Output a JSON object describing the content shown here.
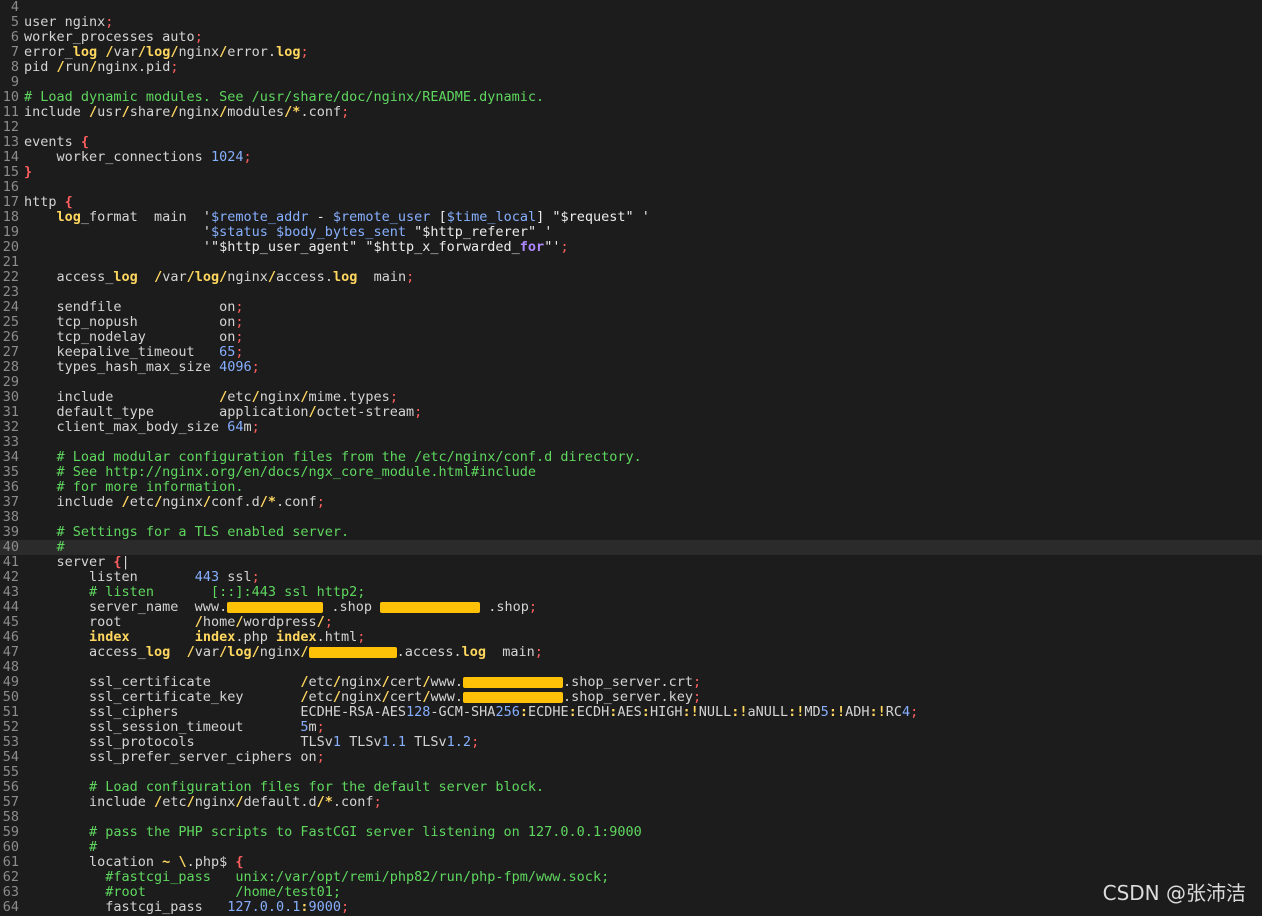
{
  "watermark": "CSDN @张沛洁",
  "colors": {
    "background": "#1c1c1c",
    "comment": "#5fd75f",
    "keyword": "#ffd75f",
    "number": "#87afff",
    "brace": "#ff5f5f",
    "redaction": "#ffc107"
  },
  "lines": [
    {
      "n": "4",
      "tokens": []
    },
    {
      "n": "5",
      "tokens": [
        [
          "",
          "user nginx"
        ],
        [
          "sp",
          ";"
        ]
      ]
    },
    {
      "n": "6",
      "tokens": [
        [
          "",
          "worker_processes auto"
        ],
        [
          "sp",
          ";"
        ]
      ]
    },
    {
      "n": "7",
      "tokens": [
        [
          "",
          "error_"
        ],
        [
          "kw",
          "log"
        ],
        [
          "",
          " "
        ],
        [
          "op",
          "/"
        ],
        [
          "",
          "var"
        ],
        [
          "op",
          "/"
        ],
        [
          "kw",
          "log"
        ],
        [
          "op",
          "/"
        ],
        [
          "",
          "nginx"
        ],
        [
          "op",
          "/"
        ],
        [
          "",
          "error."
        ],
        [
          "kw",
          "log"
        ],
        [
          "sp",
          ";"
        ]
      ]
    },
    {
      "n": "8",
      "tokens": [
        [
          "",
          "pid "
        ],
        [
          "op",
          "/"
        ],
        [
          "",
          "run"
        ],
        [
          "op",
          "/"
        ],
        [
          "",
          "nginx.pid"
        ],
        [
          "sp",
          ";"
        ]
      ]
    },
    {
      "n": "9",
      "tokens": []
    },
    {
      "n": "10",
      "tokens": [
        [
          "cm",
          "# Load dynamic modules. See /usr/share/doc/nginx/README.dynamic."
        ]
      ]
    },
    {
      "n": "11",
      "tokens": [
        [
          "",
          "include "
        ],
        [
          "op",
          "/"
        ],
        [
          "",
          "usr"
        ],
        [
          "op",
          "/"
        ],
        [
          "",
          "share"
        ],
        [
          "op",
          "/"
        ],
        [
          "",
          "nginx"
        ],
        [
          "op",
          "/"
        ],
        [
          "",
          "modules"
        ],
        [
          "op",
          "/*"
        ],
        [
          "",
          ".conf"
        ],
        [
          "sp",
          ";"
        ]
      ]
    },
    {
      "n": "12",
      "tokens": []
    },
    {
      "n": "13",
      "tokens": [
        [
          "",
          "events "
        ],
        [
          "br",
          "{"
        ]
      ]
    },
    {
      "n": "14",
      "tokens": [
        [
          "",
          "    worker_connections "
        ],
        [
          "num",
          "1024"
        ],
        [
          "sp",
          ";"
        ]
      ]
    },
    {
      "n": "15",
      "tokens": [
        [
          "br",
          "}"
        ]
      ]
    },
    {
      "n": "16",
      "tokens": []
    },
    {
      "n": "17",
      "tokens": [
        [
          "",
          "http "
        ],
        [
          "br",
          "{"
        ]
      ]
    },
    {
      "n": "18",
      "tokens": [
        [
          "",
          "    "
        ],
        [
          "kw",
          "log"
        ],
        [
          "",
          "_format  main  "
        ],
        [
          "str",
          "'"
        ],
        [
          "var",
          "$remote_addr"
        ],
        [
          "str",
          " - "
        ],
        [
          "var",
          "$remote_user"
        ],
        [
          "str",
          " ["
        ],
        [
          "var",
          "$time_local"
        ],
        [
          "str",
          "] \"$request\" '"
        ]
      ]
    },
    {
      "n": "19",
      "tokens": [
        [
          "",
          "                      "
        ],
        [
          "str",
          "'"
        ],
        [
          "var",
          "$status $body_bytes_sent"
        ],
        [
          "str",
          " \"$http_referer\" '"
        ]
      ]
    },
    {
      "n": "20",
      "tokens": [
        [
          "",
          "                      "
        ],
        [
          "str",
          "'\"$http_user_agent\" \"$http_x_forwarded_"
        ],
        [
          "for",
          "for"
        ],
        [
          "str",
          "\"'"
        ],
        [
          "sp",
          ";"
        ]
      ]
    },
    {
      "n": "21",
      "tokens": []
    },
    {
      "n": "22",
      "tokens": [
        [
          "",
          "    access_"
        ],
        [
          "kw",
          "log"
        ],
        [
          "",
          "  "
        ],
        [
          "op",
          "/"
        ],
        [
          "",
          "var"
        ],
        [
          "op",
          "/"
        ],
        [
          "kw",
          "log"
        ],
        [
          "op",
          "/"
        ],
        [
          "",
          "nginx"
        ],
        [
          "op",
          "/"
        ],
        [
          "",
          "access."
        ],
        [
          "kw",
          "log"
        ],
        [
          "",
          "  main"
        ],
        [
          "sp",
          ";"
        ]
      ]
    },
    {
      "n": "23",
      "tokens": []
    },
    {
      "n": "24",
      "tokens": [
        [
          "",
          "    sendfile            on"
        ],
        [
          "sp",
          ";"
        ]
      ]
    },
    {
      "n": "25",
      "tokens": [
        [
          "",
          "    tcp_nopush          on"
        ],
        [
          "sp",
          ";"
        ]
      ]
    },
    {
      "n": "26",
      "tokens": [
        [
          "",
          "    tcp_nodelay         on"
        ],
        [
          "sp",
          ";"
        ]
      ]
    },
    {
      "n": "27",
      "tokens": [
        [
          "",
          "    keepalive_timeout   "
        ],
        [
          "num",
          "65"
        ],
        [
          "sp",
          ";"
        ]
      ]
    },
    {
      "n": "28",
      "tokens": [
        [
          "",
          "    types_hash_max_size "
        ],
        [
          "num",
          "4096"
        ],
        [
          "sp",
          ";"
        ]
      ]
    },
    {
      "n": "29",
      "tokens": []
    },
    {
      "n": "30",
      "tokens": [
        [
          "",
          "    include             "
        ],
        [
          "op",
          "/"
        ],
        [
          "",
          "etc"
        ],
        [
          "op",
          "/"
        ],
        [
          "",
          "nginx"
        ],
        [
          "op",
          "/"
        ],
        [
          "",
          "mime.types"
        ],
        [
          "sp",
          ";"
        ]
      ]
    },
    {
      "n": "31",
      "tokens": [
        [
          "",
          "    default_type        application"
        ],
        [
          "op",
          "/"
        ],
        [
          "",
          "octet-stream"
        ],
        [
          "sp",
          ";"
        ]
      ]
    },
    {
      "n": "32",
      "tokens": [
        [
          "",
          "    client_max_body_size "
        ],
        [
          "num",
          "64"
        ],
        [
          "",
          "m"
        ],
        [
          "sp",
          ";"
        ]
      ]
    },
    {
      "n": "33",
      "tokens": []
    },
    {
      "n": "34",
      "tokens": [
        [
          "cm",
          "    # Load modular configuration files from the /etc/nginx/conf.d directory."
        ]
      ]
    },
    {
      "n": "35",
      "tokens": [
        [
          "cm",
          "    # See http://nginx.org/en/docs/ngx_core_module.html#include"
        ]
      ]
    },
    {
      "n": "36",
      "tokens": [
        [
          "cm",
          "    # for more information."
        ]
      ]
    },
    {
      "n": "37",
      "tokens": [
        [
          "",
          "    include "
        ],
        [
          "op",
          "/"
        ],
        [
          "",
          "etc"
        ],
        [
          "op",
          "/"
        ],
        [
          "",
          "nginx"
        ],
        [
          "op",
          "/"
        ],
        [
          "",
          "conf.d"
        ],
        [
          "op",
          "/*"
        ],
        [
          "",
          ".conf"
        ],
        [
          "sp",
          ";"
        ]
      ]
    },
    {
      "n": "38",
      "tokens": []
    },
    {
      "n": "39",
      "tokens": [
        [
          "cm",
          "    # Settings for a TLS enabled server."
        ]
      ]
    },
    {
      "n": "40",
      "cursor": true,
      "tokens": [
        [
          "cm",
          "    #"
        ]
      ]
    },
    {
      "n": "41",
      "tokens": [
        [
          "",
          "    server "
        ],
        [
          "br",
          "{"
        ],
        [
          "",
          "|"
        ]
      ]
    },
    {
      "n": "42",
      "tokens": [
        [
          "",
          "        listen       "
        ],
        [
          "num",
          "443"
        ],
        [
          "",
          " ssl"
        ],
        [
          "sp",
          ";"
        ]
      ]
    },
    {
      "n": "43",
      "tokens": [
        [
          "cm",
          "        # listen       [::]:443 ssl http2;"
        ]
      ]
    },
    {
      "n": "44",
      "tokens": [
        [
          "",
          "        server_name  www."
        ],
        [
          "red",
          "redacted-domain"
        ],
        [
          "",
          " .shop "
        ],
        [
          "red",
          "redacted-domain-2"
        ],
        [
          "",
          " .shop"
        ],
        [
          "sp",
          ";"
        ]
      ]
    },
    {
      "n": "45",
      "tokens": [
        [
          "",
          "        root         "
        ],
        [
          "op",
          "/"
        ],
        [
          "",
          "home"
        ],
        [
          "op",
          "/"
        ],
        [
          "",
          "wordpress"
        ],
        [
          "op",
          "/"
        ],
        [
          "sp",
          ";"
        ]
      ]
    },
    {
      "n": "46",
      "tokens": [
        [
          "",
          "        "
        ],
        [
          "kw",
          "index"
        ],
        [
          "",
          "        "
        ],
        [
          "kw",
          "index"
        ],
        [
          "",
          ".php "
        ],
        [
          "kw",
          "index"
        ],
        [
          "",
          ".html"
        ],
        [
          "sp",
          ";"
        ]
      ]
    },
    {
      "n": "47",
      "tokens": [
        [
          "",
          "        access_"
        ],
        [
          "kw",
          "log"
        ],
        [
          "",
          "  "
        ],
        [
          "op",
          "/"
        ],
        [
          "",
          "var"
        ],
        [
          "op",
          "/"
        ],
        [
          "kw",
          "log"
        ],
        [
          "op",
          "/"
        ],
        [
          "",
          "nginx"
        ],
        [
          "op",
          "/"
        ],
        [
          "red",
          "redacted-name"
        ],
        [
          "",
          ".access."
        ],
        [
          "kw",
          "log"
        ],
        [
          "",
          "  main"
        ],
        [
          "sp",
          ";"
        ]
      ]
    },
    {
      "n": "48",
      "tokens": []
    },
    {
      "n": "49",
      "tokens": [
        [
          "",
          "        ssl_certificate           "
        ],
        [
          "op",
          "/"
        ],
        [
          "",
          "etc"
        ],
        [
          "op",
          "/"
        ],
        [
          "",
          "nginx"
        ],
        [
          "op",
          "/"
        ],
        [
          "",
          "cert"
        ],
        [
          "op",
          "/"
        ],
        [
          "",
          "www."
        ],
        [
          "red",
          "redacted-x"
        ],
        [
          "",
          ".shop_server.crt"
        ],
        [
          "sp",
          ";"
        ]
      ]
    },
    {
      "n": "50",
      "tokens": [
        [
          "",
          "        ssl_certificate_key       "
        ],
        [
          "op",
          "/"
        ],
        [
          "",
          "etc"
        ],
        [
          "op",
          "/"
        ],
        [
          "",
          "nginx"
        ],
        [
          "op",
          "/"
        ],
        [
          "",
          "cert"
        ],
        [
          "op",
          "/"
        ],
        [
          "",
          "www."
        ],
        [
          "red",
          "redacted-x"
        ],
        [
          "",
          ".shop_server.key"
        ],
        [
          "sp",
          ";"
        ]
      ]
    },
    {
      "n": "51",
      "tokens": [
        [
          "",
          "        ssl_ciphers               ECDHE-RSA-AES"
        ],
        [
          "num",
          "128"
        ],
        [
          "",
          "-GCM-SHA"
        ],
        [
          "num",
          "256"
        ],
        [
          "op",
          ":"
        ],
        [
          "",
          "ECDHE"
        ],
        [
          "op",
          ":"
        ],
        [
          "",
          "ECDH"
        ],
        [
          "op",
          ":"
        ],
        [
          "",
          "AES"
        ],
        [
          "op",
          ":"
        ],
        [
          "",
          "HIGH"
        ],
        [
          "op",
          ":!"
        ],
        [
          "",
          "NULL"
        ],
        [
          "op",
          ":!"
        ],
        [
          "",
          "aNULL"
        ],
        [
          "op",
          ":!"
        ],
        [
          "",
          "MD"
        ],
        [
          "num",
          "5"
        ],
        [
          "op",
          ":!"
        ],
        [
          "",
          "ADH"
        ],
        [
          "op",
          ":!"
        ],
        [
          "",
          "RC"
        ],
        [
          "num",
          "4"
        ],
        [
          "sp",
          ";"
        ]
      ]
    },
    {
      "n": "52",
      "tokens": [
        [
          "",
          "        ssl_session_timeout       "
        ],
        [
          "num",
          "5"
        ],
        [
          "",
          "m"
        ],
        [
          "sp",
          ";"
        ]
      ]
    },
    {
      "n": "53",
      "tokens": [
        [
          "",
          "        ssl_protocols             TLSv"
        ],
        [
          "num",
          "1"
        ],
        [
          "",
          " TLSv"
        ],
        [
          "num",
          "1.1"
        ],
        [
          "",
          " TLSv"
        ],
        [
          "num",
          "1.2"
        ],
        [
          "sp",
          ";"
        ]
      ]
    },
    {
      "n": "54",
      "tokens": [
        [
          "",
          "        ssl_prefer_server_ciphers on"
        ],
        [
          "sp",
          ";"
        ]
      ]
    },
    {
      "n": "55",
      "tokens": []
    },
    {
      "n": "56",
      "tokens": [
        [
          "cm",
          "        # Load configuration files for the default server block."
        ]
      ]
    },
    {
      "n": "57",
      "tokens": [
        [
          "",
          "        include "
        ],
        [
          "op",
          "/"
        ],
        [
          "",
          "etc"
        ],
        [
          "op",
          "/"
        ],
        [
          "",
          "nginx"
        ],
        [
          "op",
          "/"
        ],
        [
          "",
          "default.d"
        ],
        [
          "op",
          "/*"
        ],
        [
          "",
          ".conf"
        ],
        [
          "sp",
          ";"
        ]
      ]
    },
    {
      "n": "58",
      "tokens": []
    },
    {
      "n": "59",
      "tokens": [
        [
          "cm",
          "        # pass the PHP scripts to FastCGI server listening on 127.0.0.1:9000"
        ]
      ]
    },
    {
      "n": "60",
      "tokens": [
        [
          "cm",
          "        #"
        ]
      ]
    },
    {
      "n": "61",
      "tokens": [
        [
          "",
          "        location "
        ],
        [
          "op",
          "~"
        ],
        [
          "",
          " "
        ],
        [
          "op",
          "\\"
        ],
        [
          "",
          ".php$ "
        ],
        [
          "br",
          "{"
        ]
      ]
    },
    {
      "n": "62",
      "tokens": [
        [
          "cm",
          "          #fastcgi_pass   unix:/var/opt/remi/php82/run/php-fpm/www.sock;"
        ]
      ]
    },
    {
      "n": "63",
      "tokens": [
        [
          "cm",
          "          #root           /home/test01;"
        ]
      ]
    },
    {
      "n": "64",
      "tokens": [
        [
          "",
          "          fastcgi_pass   "
        ],
        [
          "num",
          "127.0.0.1"
        ],
        [
          "op",
          ":"
        ],
        [
          "num",
          "9000"
        ],
        [
          "sp",
          ";"
        ]
      ]
    }
  ]
}
